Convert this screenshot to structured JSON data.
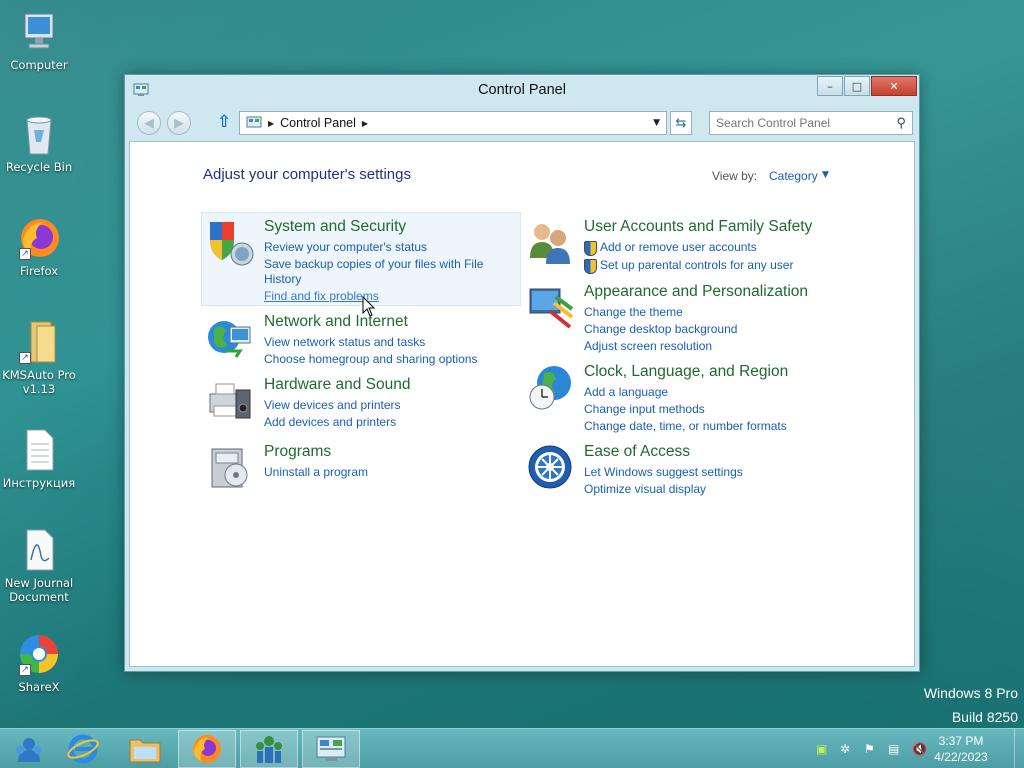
{
  "desktop": {
    "icons": [
      {
        "label": "Computer"
      },
      {
        "label": "Recycle Bin"
      },
      {
        "label": "Firefox"
      },
      {
        "label": "KMSAuto Pro v1.13"
      },
      {
        "label": "Инструкция"
      },
      {
        "label": "New Journal Document"
      },
      {
        "label": "ShareX"
      }
    ],
    "watermark": {
      "line1": "Windows 8 Pro",
      "line2": "Build 8250"
    }
  },
  "window": {
    "title": "Control Panel",
    "buttons": {
      "minimize": "–",
      "maximize": "□",
      "close": "✕"
    },
    "address": {
      "crumb": "Control Panel"
    },
    "search": {
      "placeholder": "Search Control Panel"
    },
    "heading": "Adjust your computer's settings",
    "view_by": {
      "label": "View by:",
      "value": "Category"
    },
    "categories": {
      "system": {
        "title": "System and Security",
        "links": [
          "Review your computer's status",
          "Save backup copies of your files with File",
          "History",
          "Find and fix problems"
        ]
      },
      "network": {
        "title": "Network and Internet",
        "links": [
          "View network status and tasks",
          "Choose homegroup and sharing options"
        ]
      },
      "hardware": {
        "title": "Hardware and Sound",
        "links": [
          "View devices and printers",
          "Add devices and printers"
        ]
      },
      "programs": {
        "title": "Programs",
        "links": [
          "Uninstall a program"
        ]
      },
      "users": {
        "title": "User Accounts and Family Safety",
        "links": [
          "Add or remove user accounts",
          "Set up parental controls for any user"
        ]
      },
      "appearance": {
        "title": "Appearance and Personalization",
        "links": [
          "Change the theme",
          "Change desktop background",
          "Adjust screen resolution"
        ]
      },
      "clock": {
        "title": "Clock, Language, and Region",
        "links": [
          "Add a language",
          "Change input methods",
          "Change date, time, or number formats"
        ]
      },
      "ease": {
        "title": "Ease of Access",
        "links": [
          "Let Windows suggest settings",
          "Optimize visual display"
        ]
      }
    }
  },
  "taskbar": {
    "clock": {
      "time": "3:37 PM",
      "date": "4/22/2023"
    }
  },
  "colors": {
    "accent": "#1a5fb4",
    "category_title": "#1f6b2e",
    "heading": "#1e3287"
  }
}
